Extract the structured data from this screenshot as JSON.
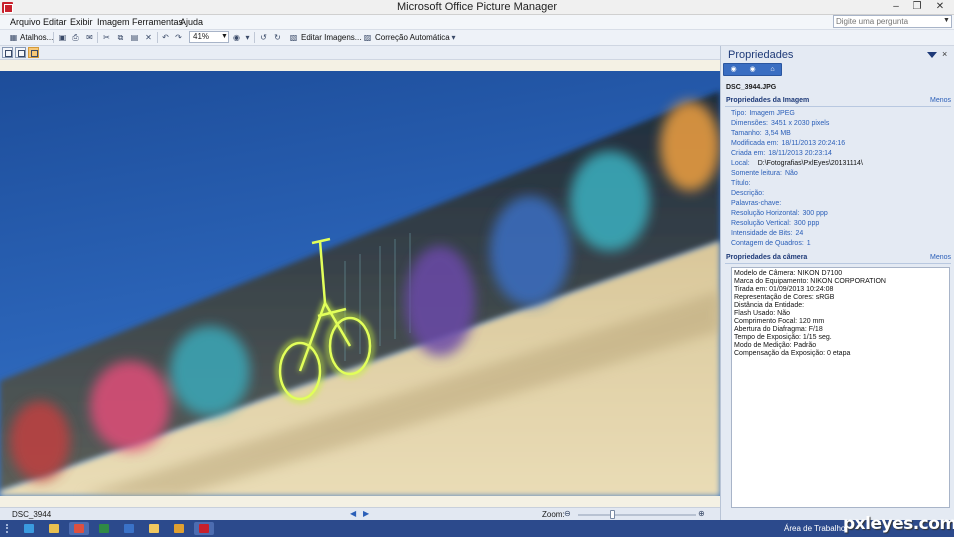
{
  "window": {
    "title": "Microsoft Office Picture Manager",
    "min": "–",
    "max": "❐",
    "close": "✕"
  },
  "menu": {
    "items": [
      {
        "label": "Arquivo"
      },
      {
        "label": "Editar"
      },
      {
        "label": "Exibir"
      },
      {
        "label": "Imagem"
      },
      {
        "label": "Ferramentas"
      },
      {
        "label": "Ajuda"
      }
    ],
    "search_placeholder": "Digite uma pergunta"
  },
  "toolbar": {
    "shortcuts_label": "Atalhos...",
    "zoom_value": "41%",
    "edit_images_label": "Editar Imagens...",
    "auto_correct_label": "Correção Automática"
  },
  "status": {
    "filename": "DSC_3944",
    "zoom_label": "Zoom:",
    "zoom_fraction": 0.29
  },
  "taskpane": {
    "title": "Propriedades",
    "close": "×",
    "file_name": "DSC_3944.JPG",
    "image_section": {
      "title": "Propriedades da Imagem",
      "link": "Menos"
    },
    "image_props": [
      {
        "label": "Tipo:",
        "value": "Imagem JPEG"
      },
      {
        "label": "Dimensões:",
        "value": "3451 x 2030 pixels"
      },
      {
        "label": "Tamanho:",
        "value": "3,54 MB"
      },
      {
        "label": "Modificada em:",
        "value": "18/11/2013 20:24:16"
      },
      {
        "label": "Criada em:",
        "value": "18/11/2013 20:23:14"
      },
      {
        "label": "Local:",
        "value": "D:\\Fotografias\\PxlEyes\\20131114\\"
      },
      {
        "label": "Somente leitura:",
        "value": "Não"
      },
      {
        "label": "Título:",
        "value": ""
      },
      {
        "label": "Descrição:",
        "value": ""
      },
      {
        "label": "Palavras-chave:",
        "value": ""
      },
      {
        "label": "Resolução Horizontal:",
        "value": "300 ppp"
      },
      {
        "label": "Resolução Vertical:",
        "value": "300 ppp"
      },
      {
        "label": "Intensidade de Bits:",
        "value": "24"
      },
      {
        "label": "Contagem de Quadros:",
        "value": "1"
      }
    ],
    "camera_section": {
      "title": "Propriedades da câmera",
      "link": "Menos"
    },
    "camera_props": [
      "Modelo de Câmera: NIKON D7100",
      "Marca do Equipamento: NIKON CORPORATION",
      "Tirada em: 01/09/2013 10:24:08",
      "Representação de Cores: sRGB",
      "Distância da Entidade:",
      "Flash Usado: Não",
      "Comprimento Focal: 120 mm",
      "Abertura do Diafragma: F/18",
      "Tempo de Exposição: 1/15 seg.",
      "Modo de Medição: Padrão",
      "Compensação da Exposição: 0 etapa"
    ]
  },
  "taskbar": {
    "desktop_label": "Área de Trabalho",
    "watermark": "pxleyes.com",
    "apps": [
      {
        "name": "ie",
        "color": "#3a9be0"
      },
      {
        "name": "explorer",
        "color": "#e8c050"
      },
      {
        "name": "chrome",
        "color": "#dd5040"
      },
      {
        "name": "excel",
        "color": "#2f8a45"
      },
      {
        "name": "outlook",
        "color": "#3a72c8"
      },
      {
        "name": "folder",
        "color": "#f0c860"
      },
      {
        "name": "media",
        "color": "#e0a030"
      },
      {
        "name": "picture-manager",
        "color": "#c8202c"
      }
    ]
  }
}
